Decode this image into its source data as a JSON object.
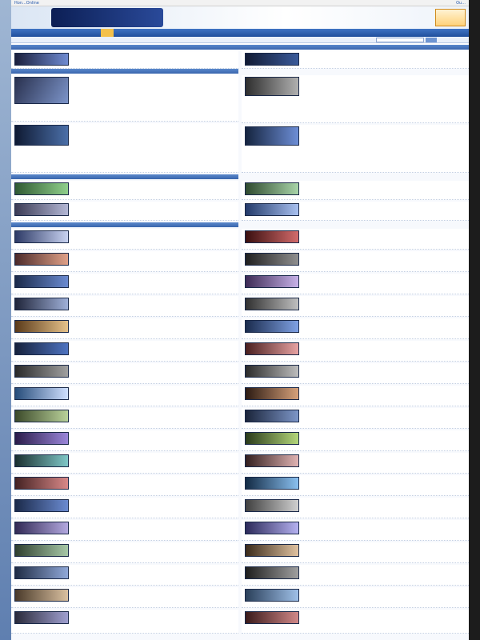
{
  "topbar": {
    "left": "Hon...Online",
    "right": "Ou..."
  },
  "banner": {
    "logo_text": "",
    "promo_text": ""
  },
  "nav": {
    "items": [
      "",
      "",
      "",
      "",
      "",
      "",
      "",
      ""
    ],
    "active_index": 7
  },
  "searchbar": {
    "announce": "",
    "search_placeholder": "",
    "search_button": "",
    "advanced_link": ""
  },
  "sections": {
    "s1": "",
    "s2": "",
    "s3": "",
    "s4": "",
    "s5": ""
  },
  "authors": {
    "a1": "",
    "a2": "",
    "a3": "",
    "a4": "",
    "a5": "",
    "a6": "",
    "a7": "",
    "a8": "",
    "a9": "",
    "a10": ""
  },
  "colors": {
    "brand_blue": "#1f4f9c",
    "nav_active": "#f4c14a",
    "title_red": "#c4270d",
    "link_blue": "#1d4fb0",
    "accent_orange": "#e07612"
  }
}
